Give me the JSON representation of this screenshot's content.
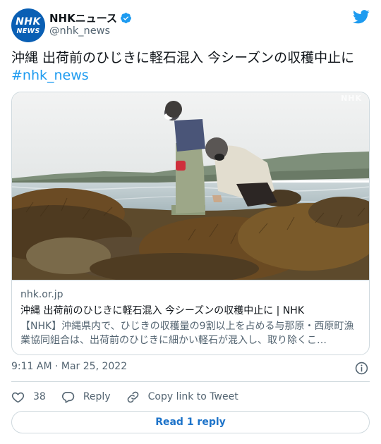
{
  "author": {
    "avatar_line1": "NHK",
    "avatar_line2": "NEWS",
    "display_name": "NHKニュース",
    "handle": "@nhk_news",
    "verified": true
  },
  "tweet": {
    "text": "沖縄 出荷前のひじきに軽石混入 今シーズンの収穫中止に",
    "hashtag": "#nhk_news"
  },
  "link_card": {
    "watermark": "NHK",
    "domain": "nhk.or.jp",
    "title": "沖縄 出荷前のひじきに軽石混入 今シーズンの収穫中止に | NHK",
    "description": "【NHK】沖縄県内で、ひじきの収穫量の9割以上を占める与那原・西原町漁業協同組合は、出荷前のひじきに細かい軽石が混入し、取り除くこ…"
  },
  "timestamp": "9:11 AM · Mar 25, 2022",
  "actions": {
    "like_count": "38",
    "reply_label": "Reply",
    "copy_label": "Copy link to Tweet"
  },
  "read_reply_label": "Read 1 reply",
  "colors": {
    "accent": "#1d9bf0",
    "brand_nhk": "#0a5fb4",
    "border": "#cfd9de",
    "muted_text": "#536471"
  },
  "icons": [
    "twitter-bird-icon",
    "verified-badge-icon",
    "info-icon",
    "heart-icon",
    "reply-bubble-icon",
    "link-icon"
  ]
}
